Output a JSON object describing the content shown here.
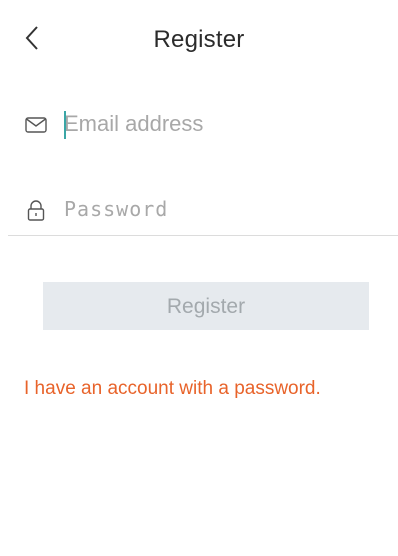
{
  "header": {
    "back_icon": "chevron-left-icon",
    "title": "Register"
  },
  "form": {
    "email": {
      "icon": "envelope-icon",
      "placeholder": "Email address",
      "value": ""
    },
    "password": {
      "icon": "lock-icon",
      "placeholder": "Password",
      "value": ""
    }
  },
  "actions": {
    "register_label": "Register",
    "account_link": "I have an account with a password."
  },
  "colors": {
    "link": "#e8632a",
    "button_bg": "#e6eaee",
    "button_text": "#a3a9ad",
    "caret": "#3aa6a6"
  }
}
